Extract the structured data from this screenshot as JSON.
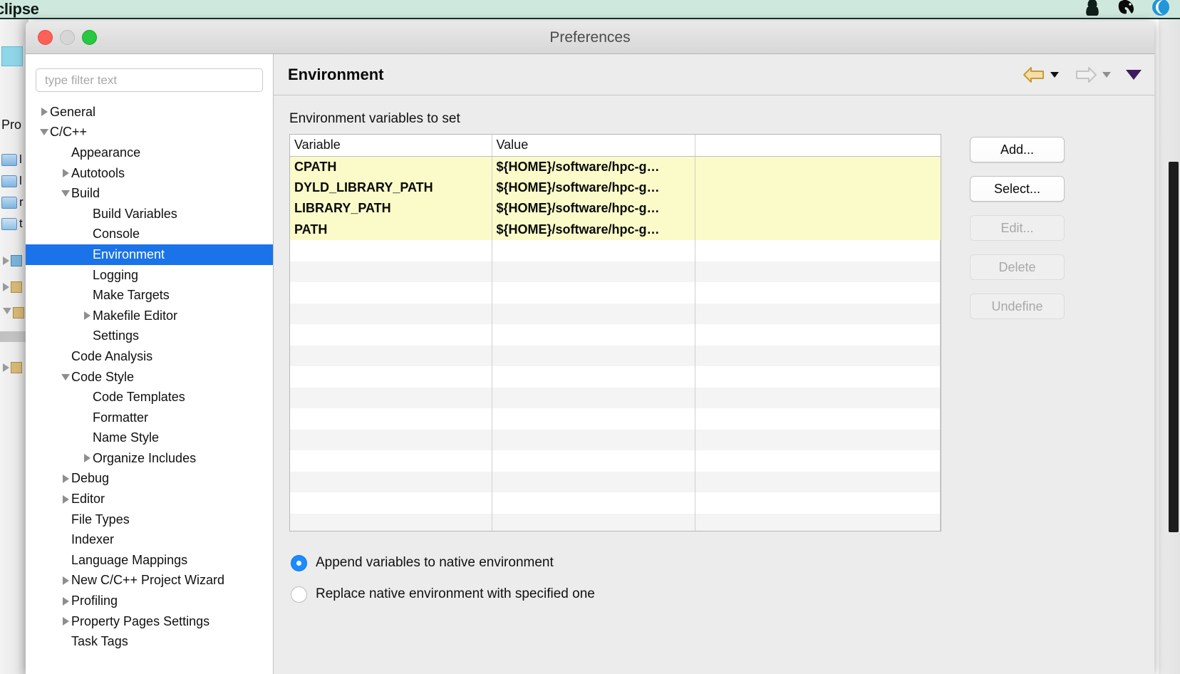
{
  "menubar": {
    "app_name": "clipse",
    "icons": [
      "penguin-icon",
      "evernote-elephant-icon",
      "blue-moon-icon"
    ]
  },
  "background": {
    "project_label": "Pro",
    "tree_letters": [
      "l",
      "l",
      "r",
      "t"
    ]
  },
  "dialog": {
    "title": "Preferences",
    "window_controls": {
      "close": "close-button",
      "minimize": "minimize-button",
      "maximize": "maximize-button"
    }
  },
  "filter": {
    "placeholder": "type filter text",
    "value": ""
  },
  "tree": {
    "items": [
      {
        "label": "General",
        "indent": 0,
        "twisty": "collapsed",
        "selected": false
      },
      {
        "label": "C/C++",
        "indent": 0,
        "twisty": "expanded",
        "selected": false
      },
      {
        "label": "Appearance",
        "indent": 1,
        "twisty": "none",
        "selected": false
      },
      {
        "label": "Autotools",
        "indent": 1,
        "twisty": "collapsed",
        "selected": false
      },
      {
        "label": "Build",
        "indent": 1,
        "twisty": "expanded",
        "selected": false
      },
      {
        "label": "Build Variables",
        "indent": 2,
        "twisty": "none",
        "selected": false
      },
      {
        "label": "Console",
        "indent": 2,
        "twisty": "none",
        "selected": false
      },
      {
        "label": "Environment",
        "indent": 2,
        "twisty": "none",
        "selected": true
      },
      {
        "label": "Logging",
        "indent": 2,
        "twisty": "none",
        "selected": false
      },
      {
        "label": "Make Targets",
        "indent": 2,
        "twisty": "none",
        "selected": false
      },
      {
        "label": "Makefile Editor",
        "indent": 2,
        "twisty": "collapsed",
        "selected": false
      },
      {
        "label": "Settings",
        "indent": 2,
        "twisty": "none",
        "selected": false
      },
      {
        "label": "Code Analysis",
        "indent": 1,
        "twisty": "none",
        "selected": false
      },
      {
        "label": "Code Style",
        "indent": 1,
        "twisty": "expanded",
        "selected": false
      },
      {
        "label": "Code Templates",
        "indent": 2,
        "twisty": "none",
        "selected": false
      },
      {
        "label": "Formatter",
        "indent": 2,
        "twisty": "none",
        "selected": false
      },
      {
        "label": "Name Style",
        "indent": 2,
        "twisty": "none",
        "selected": false
      },
      {
        "label": "Organize Includes",
        "indent": 2,
        "twisty": "collapsed",
        "selected": false
      },
      {
        "label": "Debug",
        "indent": 1,
        "twisty": "collapsed",
        "selected": false
      },
      {
        "label": "Editor",
        "indent": 1,
        "twisty": "collapsed",
        "selected": false
      },
      {
        "label": "File Types",
        "indent": 1,
        "twisty": "none",
        "selected": false
      },
      {
        "label": "Indexer",
        "indent": 1,
        "twisty": "none",
        "selected": false
      },
      {
        "label": "Language Mappings",
        "indent": 1,
        "twisty": "none",
        "selected": false
      },
      {
        "label": "New C/C++ Project Wizard",
        "indent": 1,
        "twisty": "collapsed",
        "selected": false
      },
      {
        "label": "Profiling",
        "indent": 1,
        "twisty": "collapsed",
        "selected": false
      },
      {
        "label": "Property Pages Settings",
        "indent": 1,
        "twisty": "collapsed",
        "selected": false
      },
      {
        "label": "Task Tags",
        "indent": 1,
        "twisty": "none",
        "selected": false
      }
    ]
  },
  "page": {
    "title": "Environment",
    "section_label": "Environment variables to set",
    "nav": {
      "back_icon": "back-arrow-icon",
      "back_dropdown_icon": "chevron-down-icon",
      "forward_icon": "forward-arrow-icon",
      "forward_dropdown_icon": "chevron-down-icon",
      "menu_icon": "view-menu-chevron-icon"
    }
  },
  "table": {
    "columns": [
      "Variable",
      "Value"
    ],
    "rows": [
      {
        "variable": "CPATH",
        "value": "${HOME}/software/hpc-g…"
      },
      {
        "variable": "DYLD_LIBRARY_PATH",
        "value": "${HOME}/software/hpc-g…"
      },
      {
        "variable": "LIBRARY_PATH",
        "value": "${HOME}/software/hpc-g…"
      },
      {
        "variable": "PATH",
        "value": "${HOME}/software/hpc-g…"
      }
    ],
    "empty_row_count": 15
  },
  "buttons": [
    {
      "label": "Add...",
      "enabled": true
    },
    {
      "label": "Select...",
      "enabled": true
    },
    {
      "label": "Edit...",
      "enabled": false
    },
    {
      "label": "Delete",
      "enabled": false
    },
    {
      "label": "Undefine",
      "enabled": false
    }
  ],
  "radio_options": [
    {
      "label": "Append variables to native environment",
      "selected": true
    },
    {
      "label": "Replace native environment with specified one",
      "selected": false
    }
  ],
  "colors": {
    "selection_blue": "#1a73e8",
    "row_highlight_yellow": "#fbfbc9",
    "radio_blue": "#1a8cff",
    "menubar_mint": "#cfe8dd"
  }
}
